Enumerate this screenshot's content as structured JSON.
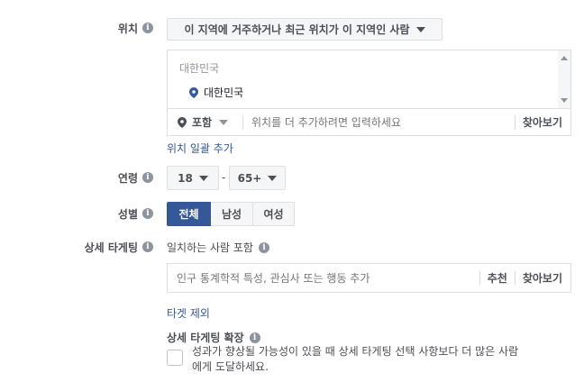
{
  "location": {
    "label": "위치",
    "filter": "이 지역에 거주하거나 최근 위치가 이 지역인 사람",
    "group_header": "대한민국",
    "selected": "대한민국",
    "include": "포함",
    "placeholder": "위치를 더 추가하려면 입력하세요",
    "browse": "찾아보기",
    "bulk_add": "위치 일괄 추가"
  },
  "age": {
    "label": "연령",
    "min": "18",
    "dash": "-",
    "max": "65+"
  },
  "gender": {
    "label": "성별",
    "options": [
      "전체",
      "남성",
      "여성"
    ],
    "selected": "전체"
  },
  "detailed": {
    "label": "상세 타게팅",
    "include_label": "일치하는 사람 포함",
    "placeholder": "인구 통계학적 특성, 관심사 또는 행동 추가",
    "suggest": "추천",
    "browse": "찾아보기",
    "exclude": "타겟 제외",
    "expansion_title": "상세 타게팅 확장",
    "expansion_text_1": "성과가 향상될 가능성이 있을 때 상세 타게팅 선택 사항보다 더 많은 사람",
    "expansion_text_2": "에게 도달하세요."
  },
  "colors": {
    "selected_bg": "#365899",
    "link": "#365899",
    "border": "#dddfe2"
  },
  "icons": [
    "info-icon",
    "location-pin-icon",
    "caret-down-icon",
    "scroll-up-icon",
    "scroll-down-icon"
  ]
}
